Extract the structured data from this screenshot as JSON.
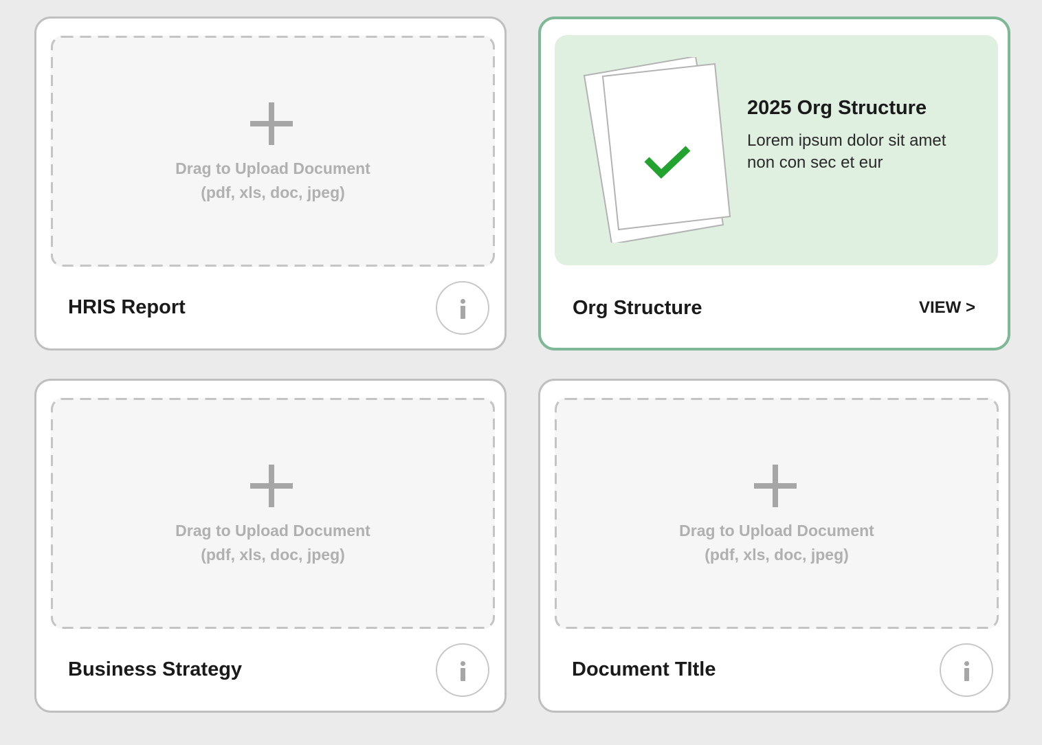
{
  "colors": {
    "page_background": "#ebebeb",
    "card_border": "#bfbfbf",
    "success_border": "#7fb897",
    "success_panel": "#dfefe0",
    "checkmark": "#22a22e",
    "muted_text": "#b0b0b0"
  },
  "cards": [
    {
      "title": "HRIS Report",
      "state": "empty",
      "upload_line1": "Drag to Upload Document",
      "upload_line2": "(pdf, xls, doc, jpeg)",
      "icon": "info-icon"
    },
    {
      "title": "Org Structure",
      "state": "uploaded",
      "document_title": "2025 Org Structure",
      "document_description": "Lorem ipsum dolor sit amet non con sec et eur",
      "action_label": "VIEW >",
      "icon": "checkmark-icon"
    },
    {
      "title": "Business Strategy",
      "state": "empty",
      "upload_line1": "Drag to Upload Document",
      "upload_line2": "(pdf, xls, doc, jpeg)",
      "icon": "info-icon"
    },
    {
      "title": "Document TItle",
      "state": "empty",
      "upload_line1": "Drag to Upload Document",
      "upload_line2": "(pdf, xls, doc, jpeg)",
      "icon": "info-icon"
    }
  ]
}
